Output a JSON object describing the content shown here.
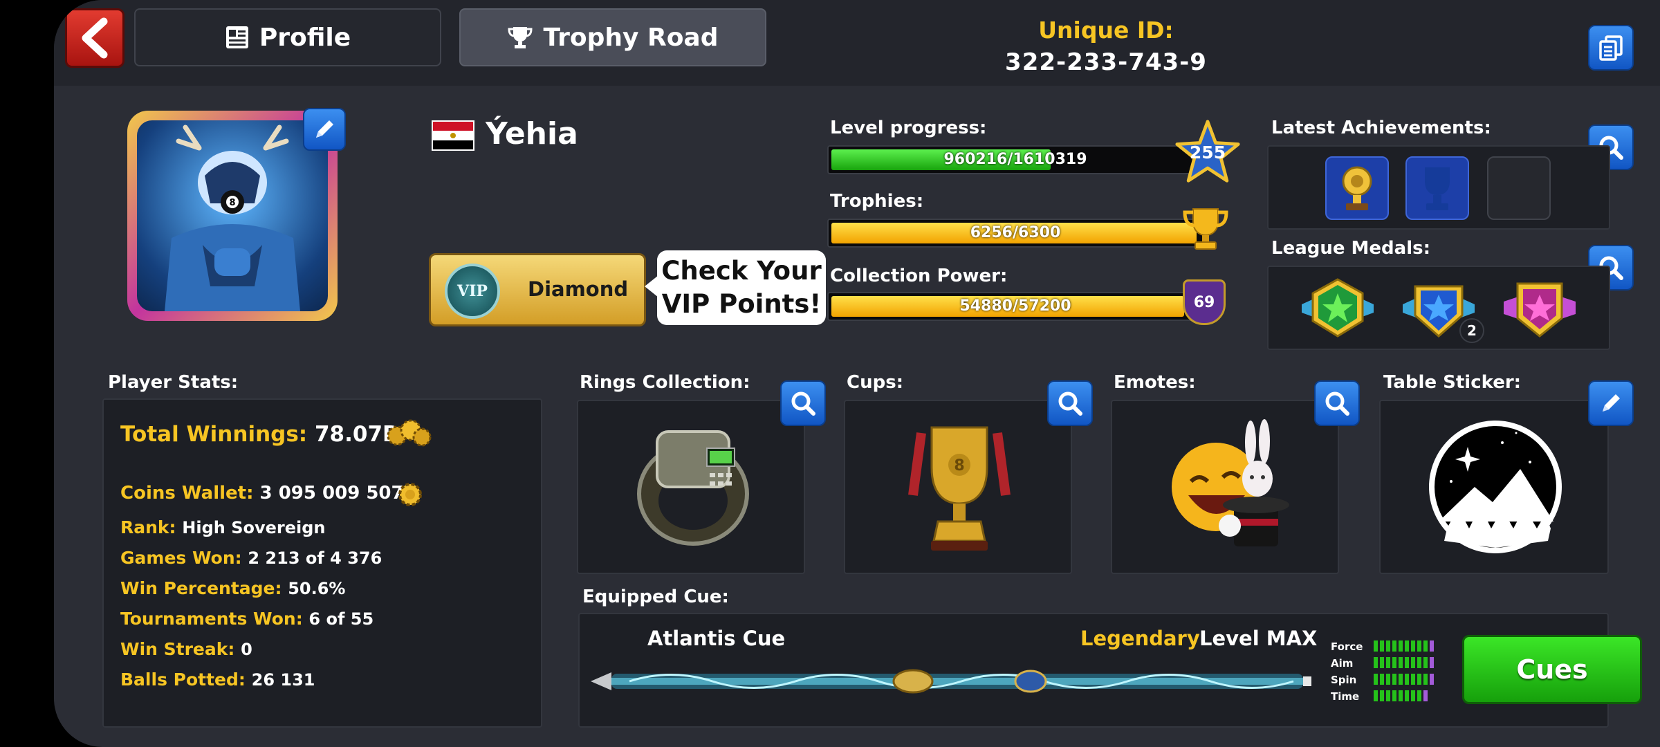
{
  "header": {
    "tabs": [
      {
        "label": "Profile"
      },
      {
        "label": "Trophy Road"
      }
    ],
    "unique_id_label": "Unique ID:",
    "unique_id_value": "322-233-743-9"
  },
  "profile": {
    "username": "Ýehia",
    "vip_badge": "VIP",
    "vip_tier": "Diamond",
    "vip_bubble_line1": "Check Your",
    "vip_bubble_line2": "VIP Points!"
  },
  "progress": {
    "level_label": "Level progress:",
    "level_text": "960216/1610319",
    "level_fraction": 0.596,
    "level_number": "255",
    "trophies_label": "Trophies:",
    "trophies_text": "6256/6300",
    "trophies_fraction": 0.993,
    "collection_label": "Collection Power:",
    "collection_text": "54880/57200",
    "collection_fraction": 0.959,
    "collection_badge": "69"
  },
  "achievements": {
    "label": "Latest Achievements:"
  },
  "medals": {
    "label": "League Medals:",
    "count_badge": "2"
  },
  "stats": {
    "label": "Player Stats:",
    "total_winnings_key": "Total Winnings:",
    "total_winnings_val": "78.07B",
    "coins_wallet_key": "Coins Wallet:",
    "coins_wallet_val": "3 095 009 507",
    "rank_key": "Rank:",
    "rank_val": "High Sovereign",
    "games_won_key": "Games Won:",
    "games_won_val": "2 213 of 4 376",
    "win_pct_key": "Win Percentage:",
    "win_pct_val": "50.6%",
    "tournaments_key": "Tournaments Won:",
    "tournaments_val": "6 of 55",
    "streak_key": "Win Streak:",
    "streak_val": "0",
    "potted_key": "Balls Potted:",
    "potted_val": "26 131"
  },
  "collections": {
    "rings_label": "Rings Collection:",
    "cups_label": "Cups:",
    "emotes_label": "Emotes:",
    "sticker_label": "Table Sticker:"
  },
  "cue": {
    "section_label": "Equipped Cue:",
    "name": "Atlantis Cue",
    "rarity": "Legendary",
    "level": "Level MAX",
    "stat_labels": [
      "Force",
      "Aim",
      "Spin",
      "Time"
    ],
    "cues_button": "Cues"
  },
  "colors": {
    "accent_yellow": "#f7c523",
    "button_blue": "#1f6fde",
    "back_red": "#d22a20",
    "cues_green": "#25c21a"
  }
}
